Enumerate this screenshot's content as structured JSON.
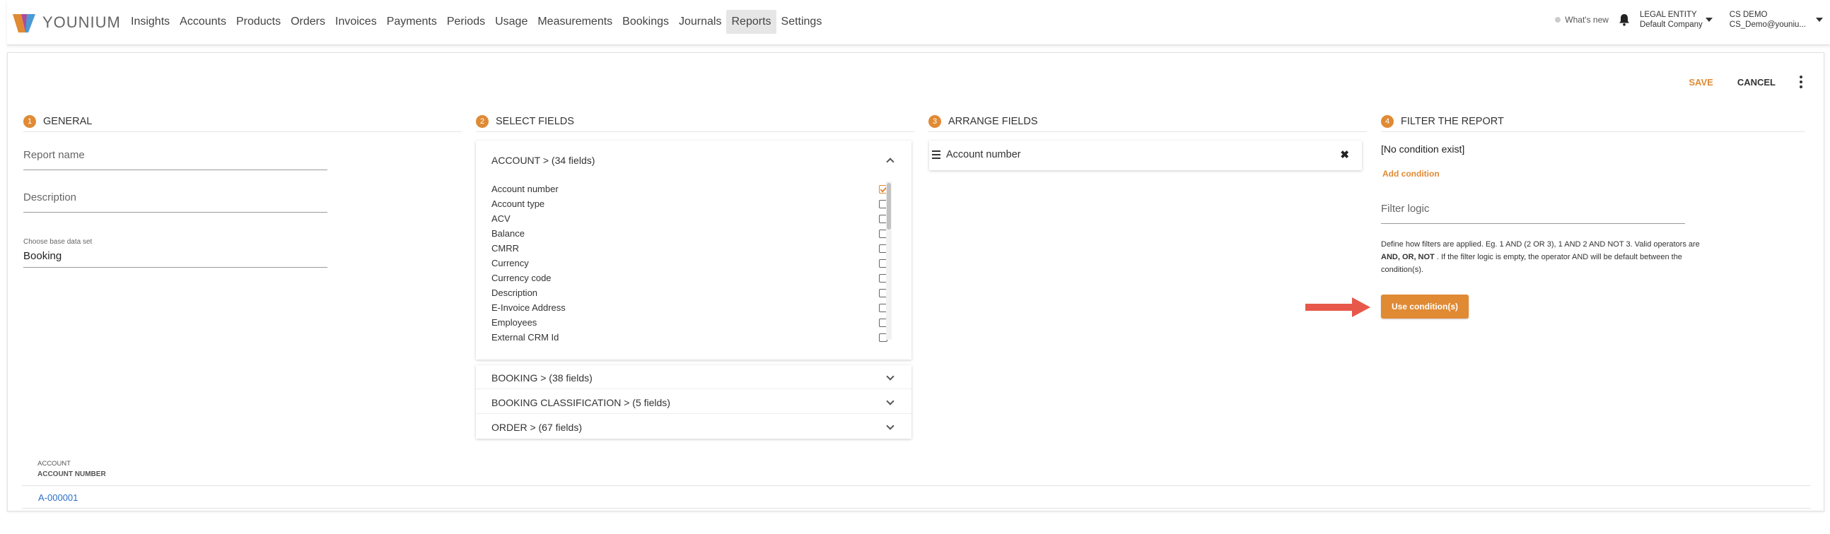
{
  "app": {
    "logo_text": "YOUNIUM"
  },
  "nav": {
    "items": [
      "Insights",
      "Accounts",
      "Products",
      "Orders",
      "Invoices",
      "Payments",
      "Periods",
      "Usage",
      "Measurements",
      "Bookings",
      "Journals",
      "Reports",
      "Settings"
    ],
    "active": "Reports"
  },
  "topright": {
    "whats_new": "What's new",
    "entity_label": "LEGAL ENTITY",
    "entity_value": "Default Company",
    "user_name": "CS DEMO",
    "user_email": "CS_Demo@youniu..."
  },
  "actions": {
    "save": "SAVE",
    "cancel": "CANCEL"
  },
  "sections": {
    "general": {
      "step": "1",
      "title": "GENERAL"
    },
    "select": {
      "step": "2",
      "title": "SELECT FIELDS"
    },
    "arrange": {
      "step": "3",
      "title": "ARRANGE FIELDS"
    },
    "filter": {
      "step": "4",
      "title": "FILTER THE REPORT"
    }
  },
  "general": {
    "report_name_placeholder": "Report name",
    "description_placeholder": "Description",
    "base_label": "Choose base data set",
    "base_value": "Booking"
  },
  "select": {
    "account_group": "ACCOUNT >  (34 fields)",
    "fields": [
      {
        "label": "Account number",
        "checked": true
      },
      {
        "label": "Account type",
        "checked": false
      },
      {
        "label": "ACV",
        "checked": false
      },
      {
        "label": "Balance",
        "checked": false
      },
      {
        "label": "CMRR",
        "checked": false
      },
      {
        "label": "Currency",
        "checked": false
      },
      {
        "label": "Currency code",
        "checked": false
      },
      {
        "label": "Description",
        "checked": false
      },
      {
        "label": "E-Invoice Address",
        "checked": false
      },
      {
        "label": "Employees",
        "checked": false
      },
      {
        "label": "External CRM Id",
        "checked": false
      }
    ],
    "groups": [
      "BOOKING >  (38 fields)",
      "BOOKING CLASSIFICATION >  (5 fields)",
      "ORDER >  (67 fields)"
    ]
  },
  "arrange": {
    "items": [
      "Account number"
    ]
  },
  "filter": {
    "no_condition": "[No condition exist]",
    "add_condition": "Add condition",
    "logic_placeholder": "Filter logic",
    "help_1": "Define how filters are applied. Eg. 1 AND (2 OR 3), 1 AND 2 AND NOT 3. Valid operators are ",
    "help_ops": "AND, OR, NOT",
    "help_2": " . If the filter logic is empty, the operator AND will be default between the condition(s).",
    "use_button": "Use condition(s)"
  },
  "preview": {
    "header_group": "ACCOUNT",
    "header_col": "ACCOUNT NUMBER",
    "rows": [
      "A-000001"
    ]
  },
  "colors": {
    "accent": "#e08a34",
    "link": "#2a6fc9",
    "arrow": "#e8584a"
  }
}
